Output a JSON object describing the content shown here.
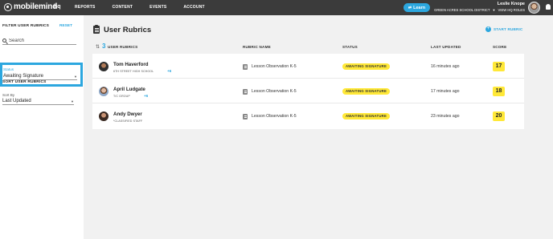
{
  "topbar": {
    "logo_text": "mobilemind",
    "product": "hq",
    "nav": [
      "REPORTS",
      "CONTENT",
      "EVENTS",
      "ACCOUNT"
    ],
    "learn_label": "Learn",
    "user_name": "Leslie Knope",
    "district": "GREEN ACRES SCHOOL DISTRICT",
    "role_link": "VIEW HQ ROLES"
  },
  "sidebar": {
    "filter_title": "FILTER USER RUBRICS",
    "reset_label": "RESET",
    "search_placeholder": "Search",
    "status_label": "Status",
    "status_value": "Awaiting Signature",
    "sort_title": "SORT USER RUBRICS",
    "sort_label": "Sort By",
    "sort_value": "Last Updated"
  },
  "main": {
    "title": "User Rubrics",
    "start_rubric": "START RUBRIC",
    "count": "3",
    "columns": {
      "user": "USER RUBRICS",
      "rubric": "RUBRIC NAME",
      "status": "STATUS",
      "updated": "LAST UPDATED",
      "score": "SCORE"
    },
    "rows": [
      {
        "name": "Tom Haverford",
        "school": "6TH STREET HIGH SCHOOL",
        "more": "+6",
        "rubric": "Lesson Observation K-5",
        "status": "AWAITING SIGNATURE",
        "updated": "16 minutes ago",
        "score": "17"
      },
      {
        "name": "April Ludgate",
        "school": "T/C GROUP",
        "more": "+6",
        "rubric": "Lesson Observation K-5",
        "status": "AWAITING SIGNATURE",
        "updated": "17 minutes ago",
        "score": "18"
      },
      {
        "name": "Andy Dwyer",
        "school": "*CLASSIFIED STAFF",
        "more": "",
        "rubric": "Lesson Observation K-5",
        "status": "AWAITING SIGNATURE",
        "updated": "23 minutes ago",
        "score": "20"
      }
    ]
  }
}
